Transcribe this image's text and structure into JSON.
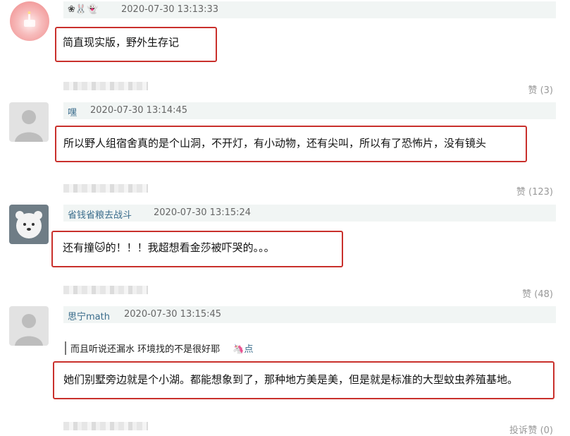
{
  "comments": [
    {
      "username_emoji": "❀🐰👻",
      "timestamp": "2020-07-30 13:13:33",
      "text": "简直现实版，野外生存记",
      "likes": "赞 (3)"
    },
    {
      "username": "嘿",
      "timestamp": "2020-07-30 13:14:45",
      "text": "所以野人组宿舍真的是个山洞，不开灯，有小动物，还有尖叫，所以有了恐怖片，没有镜头",
      "likes": "赞 (123)"
    },
    {
      "username": "省钱省粮去战斗",
      "timestamp": "2020-07-30 13:15:24",
      "text": "还有撞🐱的！！！我超想看金莎被吓哭的。。。",
      "likes": "赞 (48)"
    },
    {
      "username": "思宁math",
      "timestamp": "2020-07-30 13:15:45",
      "quote": "而且听说还漏水 环境找的不是很好耶",
      "quote_point": "🦄点",
      "text": "她们别墅旁边就是个小湖。都能想象到了，那种地方美是美，但是就是标准的大型蚊虫养殖基地。",
      "likes": "赞 (0)",
      "report": "投诉"
    }
  ]
}
